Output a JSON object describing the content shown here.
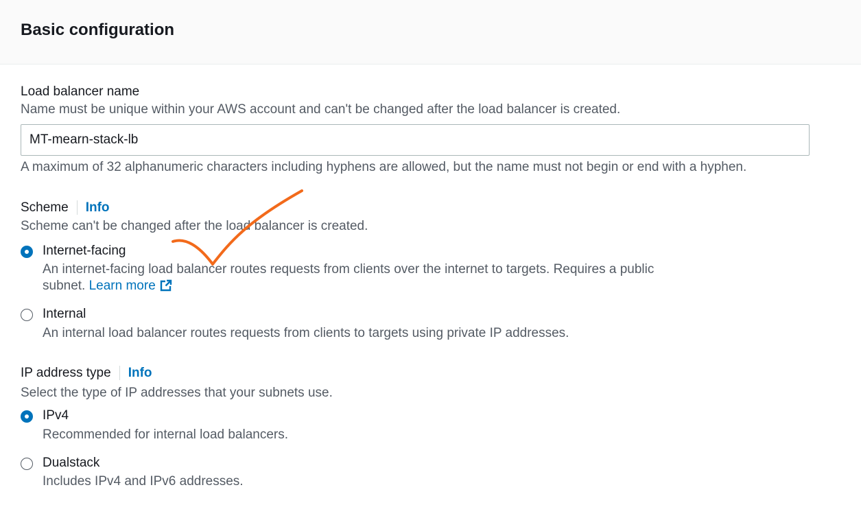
{
  "header": {
    "title": "Basic configuration"
  },
  "lb_name": {
    "label": "Load balancer name",
    "description": "Name must be unique within your AWS account and can't be changed after the load balancer is created.",
    "value": "MT-mearn-stack-lb",
    "constraint": "A maximum of 32 alphanumeric characters including hyphens are allowed, but the name must not begin or end with a hyphen."
  },
  "scheme": {
    "label": "Scheme",
    "info": "Info",
    "description": "Scheme can't be changed after the load balancer is created.",
    "options": [
      {
        "label": "Internet-facing",
        "selected": true,
        "description_line1": "An internet-facing load balancer routes requests from clients over the internet to targets. Requires a public",
        "description_line2": "subnet.",
        "link": "Learn more"
      },
      {
        "label": "Internal",
        "selected": false,
        "description_line1": "An internal load balancer routes requests from clients to targets using private IP addresses."
      }
    ]
  },
  "ip_type": {
    "label": "IP address type",
    "info": "Info",
    "description": "Select the type of IP addresses that your subnets use.",
    "options": [
      {
        "label": "IPv4",
        "selected": true,
        "description_line1": "Recommended for internal load balancers."
      },
      {
        "label": "Dualstack",
        "selected": false,
        "description_line1": "Includes IPv4 and IPv6 addresses."
      }
    ]
  },
  "colors": {
    "accent": "#0073bb",
    "annotation": "#f26a1b",
    "muted_text": "#545b64"
  },
  "icons": {
    "external_link": "external-link-icon",
    "annotation": "checkmark-annotation"
  }
}
